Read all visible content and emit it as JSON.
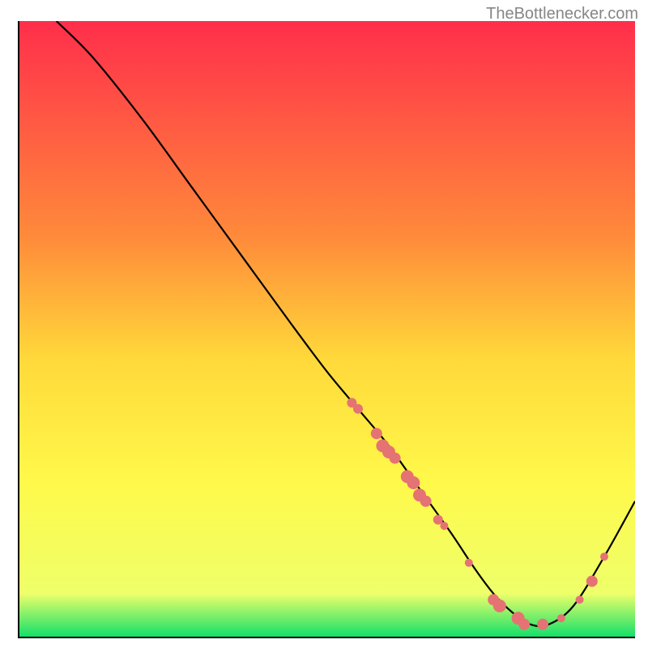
{
  "watermark": "TheBottlenecker.com",
  "chart_data": {
    "type": "line",
    "title": "",
    "xlabel": "",
    "ylabel": "",
    "xlim": [
      0,
      100
    ],
    "ylim": [
      0,
      100
    ],
    "gradient_stops": [
      {
        "offset": 0,
        "color": "#ff2e4b"
      },
      {
        "offset": 35,
        "color": "#ff8a3a"
      },
      {
        "offset": 55,
        "color": "#ffd93a"
      },
      {
        "offset": 75,
        "color": "#fff94a"
      },
      {
        "offset": 93,
        "color": "#eeff6a"
      },
      {
        "offset": 100,
        "color": "#13e06a"
      }
    ],
    "series": [
      {
        "name": "bottleneck-curve",
        "x": [
          6,
          12,
          20,
          28,
          36,
          44,
          50,
          55,
          60,
          65,
          70,
          74,
          77,
          80,
          83,
          86,
          90,
          95,
          100
        ],
        "y": [
          100,
          94,
          84,
          73,
          62,
          51,
          43,
          37,
          31,
          24,
          17,
          11,
          7,
          4,
          2,
          2,
          5,
          13,
          22
        ]
      }
    ],
    "markers": {
      "name": "highlighted-points",
      "color": "#e57373",
      "points": [
        {
          "x": 54,
          "y": 38,
          "r": 6
        },
        {
          "x": 55,
          "y": 37,
          "r": 6
        },
        {
          "x": 58,
          "y": 33,
          "r": 7
        },
        {
          "x": 59,
          "y": 31,
          "r": 8
        },
        {
          "x": 60,
          "y": 30,
          "r": 8
        },
        {
          "x": 61,
          "y": 29,
          "r": 7
        },
        {
          "x": 63,
          "y": 26,
          "r": 8
        },
        {
          "x": 64,
          "y": 25,
          "r": 8
        },
        {
          "x": 65,
          "y": 23,
          "r": 8
        },
        {
          "x": 66,
          "y": 22,
          "r": 7
        },
        {
          "x": 68,
          "y": 19,
          "r": 6
        },
        {
          "x": 69,
          "y": 18,
          "r": 5
        },
        {
          "x": 73,
          "y": 12,
          "r": 5
        },
        {
          "x": 77,
          "y": 6,
          "r": 7
        },
        {
          "x": 78,
          "y": 5,
          "r": 8
        },
        {
          "x": 81,
          "y": 3,
          "r": 8
        },
        {
          "x": 82,
          "y": 2,
          "r": 7
        },
        {
          "x": 85,
          "y": 2,
          "r": 7
        },
        {
          "x": 88,
          "y": 3,
          "r": 5
        },
        {
          "x": 91,
          "y": 6,
          "r": 5
        },
        {
          "x": 93,
          "y": 9,
          "r": 7
        },
        {
          "x": 95,
          "y": 13,
          "r": 5
        }
      ]
    }
  }
}
